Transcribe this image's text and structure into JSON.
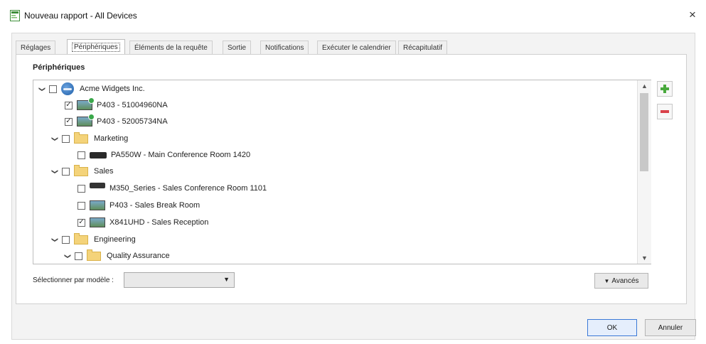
{
  "window": {
    "title": "Nouveau rapport - All Devices",
    "close_glyph": "×",
    "icon": "report-app-icon"
  },
  "tabs": [
    {
      "label": "Réglages",
      "active": false
    },
    {
      "label": "Périphériques",
      "active": true
    },
    {
      "label": "Éléments de la requête",
      "active": false
    },
    {
      "label": "Sortie",
      "active": false
    },
    {
      "label": "Notifications",
      "active": false
    },
    {
      "label": "Exécuter le calendrier",
      "active": false
    },
    {
      "label": "Récapitulatif",
      "active": false
    }
  ],
  "devices_group": {
    "label": "Périphériques",
    "tree": [
      {
        "label": "Acme Widgets Inc.",
        "kind": "organization",
        "expanded": true,
        "checked": false
      },
      {
        "label": "P403 - 51004960NA",
        "kind": "display",
        "checked": true
      },
      {
        "label": "P403 - 52005734NA",
        "kind": "display",
        "checked": true
      },
      {
        "label": "Marketing",
        "kind": "folder",
        "expanded": true,
        "checked": false
      },
      {
        "label": "PA550W - Main Conference Room 1420",
        "kind": "projector",
        "checked": false
      },
      {
        "label": "Sales",
        "kind": "folder",
        "expanded": true,
        "checked": false
      },
      {
        "label": "M350_Series - Sales Conference Room 1101",
        "kind": "projector",
        "checked": false
      },
      {
        "label": "P403 - Sales Break Room",
        "kind": "display",
        "checked": false
      },
      {
        "label": "X841UHD - Sales Reception",
        "kind": "display",
        "checked": true
      },
      {
        "label": "Engineering",
        "kind": "folder",
        "expanded": true,
        "checked": false
      },
      {
        "label": "Quality Assurance",
        "kind": "folder",
        "expanded": true,
        "checked": false
      }
    ],
    "chevron_glyph": "❯",
    "add_icon": "add-icon",
    "remove_icon": "remove-icon"
  },
  "select_by_model": {
    "label": "Sélectionner par modèle :",
    "value": "",
    "arrow_glyph": "▼"
  },
  "advanced_button": {
    "label": "Avancés",
    "arrow_glyph": "▼"
  },
  "footer": {
    "ok_label": "OK",
    "cancel_label": "Annuler"
  },
  "colors": {
    "folder": "#f4d37a",
    "add_green": "#49a93d",
    "remove_red": "#d9414a",
    "ok_border": "#3b79d6"
  }
}
